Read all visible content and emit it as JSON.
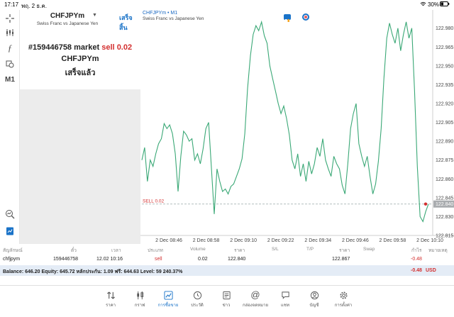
{
  "status_bar": {
    "time": "17:17",
    "date": "พฤ. 2 ธ.ค.",
    "battery": "30%"
  },
  "left_toolbar": {
    "timeframe": "M1"
  },
  "order_panel": {
    "symbol": "CHFJPYm",
    "done_label": "เสร็จสิ้น",
    "description": "Swiss Franc vs Japanese Yen",
    "order_number": "#159446758",
    "order_type": "market",
    "order_side": "sell",
    "order_volume": "0.02",
    "order_symbol": "CHFJPYm",
    "order_status": "เสร็จแล้ว"
  },
  "chart": {
    "title": "CHFJPYm • M1",
    "subtitle": "Swiss Franc vs Japanese Yen",
    "sell_line_label": "SELL 0.02",
    "current_price_label": "122.840"
  },
  "chart_data": {
    "type": "line",
    "x": [
      "2 Dec 08:46",
      "2 Dec 08:58",
      "2 Dec 09:10",
      "2 Dec 09:22",
      "2 Dec 09:34",
      "2 Dec 09:46",
      "2 Dec 09:58",
      "2 Dec 10:10"
    ],
    "ylim": [
      122.815,
      122.99
    ],
    "yticks": [
      "122.980",
      "122.965",
      "122.950",
      "122.935",
      "122.920",
      "122.905",
      "122.890",
      "122.875",
      "122.860",
      "122.845",
      "122.830",
      "122.815"
    ],
    "values": [
      122.875,
      122.885,
      122.858,
      122.875,
      122.87,
      122.88,
      122.888,
      122.892,
      122.904,
      122.9,
      122.903,
      122.896,
      122.88,
      122.85,
      122.878,
      122.898,
      122.895,
      122.89,
      122.892,
      122.875,
      122.88,
      122.872,
      122.884,
      122.9,
      122.905,
      122.868,
      122.832,
      122.868,
      122.858,
      122.85,
      122.852,
      122.848,
      122.854,
      122.856,
      122.862,
      122.868,
      122.876,
      122.896,
      122.932,
      122.958,
      122.975,
      122.982,
      122.978,
      122.985,
      122.974,
      122.968,
      122.95,
      122.94,
      122.93,
      122.92,
      122.912,
      122.918,
      122.908,
      122.895,
      122.875,
      122.868,
      122.88,
      122.862,
      122.872,
      122.858,
      122.874,
      122.864,
      122.872,
      122.885,
      122.878,
      122.892,
      122.875,
      122.868,
      122.862,
      122.878,
      122.872,
      122.868,
      122.855,
      122.848,
      122.872,
      122.9,
      122.912,
      122.92,
      122.888,
      122.878,
      122.87,
      122.878,
      122.862,
      122.848,
      122.856,
      122.874,
      122.9,
      122.94,
      122.972,
      122.984,
      122.975,
      122.968,
      122.98,
      122.962,
      122.975,
      122.985,
      122.972,
      122.98,
      122.93,
      122.87,
      122.83,
      122.826,
      122.834,
      122.84
    ],
    "sell_level": 122.84,
    "grid": false
  },
  "table": {
    "headers": [
      "สัญลักษณ์",
      "ตั๋ว",
      "เวลา",
      "ประเภท",
      "Volume",
      "ราคา",
      "S/L",
      "T/P",
      "ราคา",
      "Swap",
      "กำไร",
      "หมายเหตุ"
    ],
    "row": {
      "symbol": "chfjpym",
      "ticket": "159446758",
      "time": "12.02 10:16",
      "type": "sell",
      "volume": "0.02",
      "price": "122.840",
      "current_price": "122.867",
      "profit": "-0.48"
    },
    "balance_text": "Balance: 646.20 Equity: 645.72 หลักประกัน: 1.09 ฟรี: 644.63 Level: 59 240.37%",
    "balance_profit": "-0.48",
    "balance_currency": "USD"
  },
  "bottom_nav": [
    {
      "label": "ราคา",
      "icon": "arrows-updown-icon"
    },
    {
      "label": "กราฟ",
      "icon": "candles-icon"
    },
    {
      "label": "การซื้อขาย",
      "icon": "trade-chart-icon",
      "active": true
    },
    {
      "label": "ประวัติ",
      "icon": "history-icon"
    },
    {
      "label": "ข่าว",
      "icon": "news-icon"
    },
    {
      "label": "กล่องจดหมาย",
      "icon": "mail-at-icon"
    },
    {
      "label": "แชท",
      "icon": "chat-icon"
    },
    {
      "label": "บัญชี",
      "icon": "account-icon"
    },
    {
      "label": "การตั้งค่า",
      "icon": "gear-icon"
    }
  ],
  "colors": {
    "line": "#3aa876",
    "sell": "#d32f2f",
    "accent": "#1a73c8"
  }
}
